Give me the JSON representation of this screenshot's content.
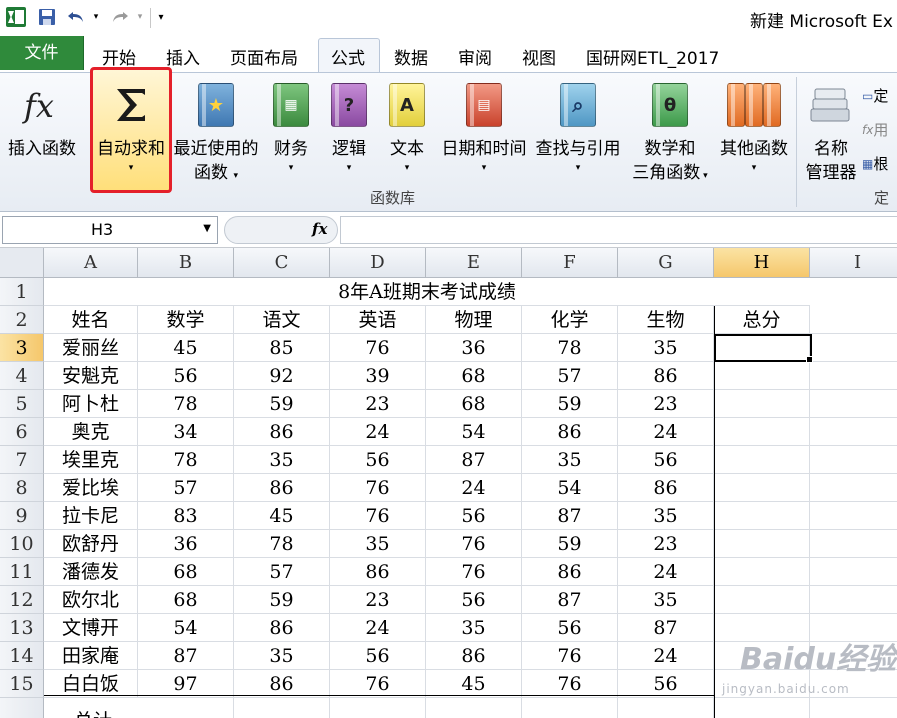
{
  "window": {
    "title": "新建 Microsoft Ex"
  },
  "quick_access": {
    "customize_glyph": "▾"
  },
  "tabs": [
    {
      "label": "文件"
    },
    {
      "label": "开始"
    },
    {
      "label": "插入"
    },
    {
      "label": "页面布局"
    },
    {
      "label": "公式"
    },
    {
      "label": "数据"
    },
    {
      "label": "审阅"
    },
    {
      "label": "视图"
    },
    {
      "label": "国研网ETL_2017"
    }
  ],
  "ribbon": {
    "group_label": "函数库",
    "group_label_2": "定",
    "buttons": {
      "insert_function": "插入函数",
      "autosum": "自动求和",
      "recent_1": "最近使用的",
      "recent_2": "函数",
      "financial": "财务",
      "logical": "逻辑",
      "text": "文本",
      "datetime": "日期和时间",
      "lookup": "查找与引用",
      "math_1": "数学和",
      "math_2": "三角函数",
      "more": "其他函数",
      "name_mgr_1": "名称",
      "name_mgr_2": "管理器"
    },
    "small": {
      "define": "定",
      "use": "用",
      "create": "根"
    }
  },
  "formula_bar": {
    "name_box": "H3",
    "fx": "fx",
    "value": ""
  },
  "sheet": {
    "columns": [
      "A",
      "B",
      "C",
      "D",
      "E",
      "F",
      "G",
      "H",
      "I"
    ],
    "rows": [
      "1",
      "2",
      "3",
      "4",
      "5",
      "6",
      "7",
      "8",
      "9",
      "10",
      "11",
      "12",
      "13",
      "14",
      "15"
    ],
    "title": "8年A班期末考试成绩",
    "headers": [
      "姓名",
      "数学",
      "语文",
      "英语",
      "物理",
      "化学",
      "生物",
      "总分"
    ],
    "data": [
      [
        "爱丽丝",
        "45",
        "85",
        "76",
        "36",
        "78",
        "35"
      ],
      [
        "安魁克",
        "56",
        "92",
        "39",
        "68",
        "57",
        "86"
      ],
      [
        "阿卜杜",
        "78",
        "59",
        "23",
        "68",
        "59",
        "23"
      ],
      [
        "奥克",
        "34",
        "86",
        "24",
        "54",
        "86",
        "24"
      ],
      [
        "埃里克",
        "78",
        "35",
        "56",
        "87",
        "35",
        "56"
      ],
      [
        "爱比埃",
        "57",
        "86",
        "76",
        "24",
        "54",
        "86"
      ],
      [
        "拉卡尼",
        "83",
        "45",
        "76",
        "56",
        "87",
        "35"
      ],
      [
        "欧舒丹",
        "36",
        "78",
        "35",
        "76",
        "59",
        "23"
      ],
      [
        "潘德发",
        "68",
        "57",
        "86",
        "76",
        "86",
        "24"
      ],
      [
        "欧尔北",
        "68",
        "59",
        "23",
        "56",
        "87",
        "35"
      ],
      [
        "文博开",
        "54",
        "86",
        "24",
        "35",
        "56",
        "87"
      ],
      [
        "田家庵",
        "87",
        "35",
        "56",
        "86",
        "76",
        "24"
      ],
      [
        "白白饭",
        "97",
        "86",
        "76",
        "45",
        "76",
        "56"
      ]
    ],
    "row16_label": "总计",
    "active_cell": "H3"
  },
  "watermark": {
    "text": "Baidu经验",
    "sub": "jingyan.baidu.com"
  },
  "colors": {
    "file_tab": "#2f8a3b",
    "highlight": "#e4202a",
    "active_header": "#f5c76b"
  }
}
